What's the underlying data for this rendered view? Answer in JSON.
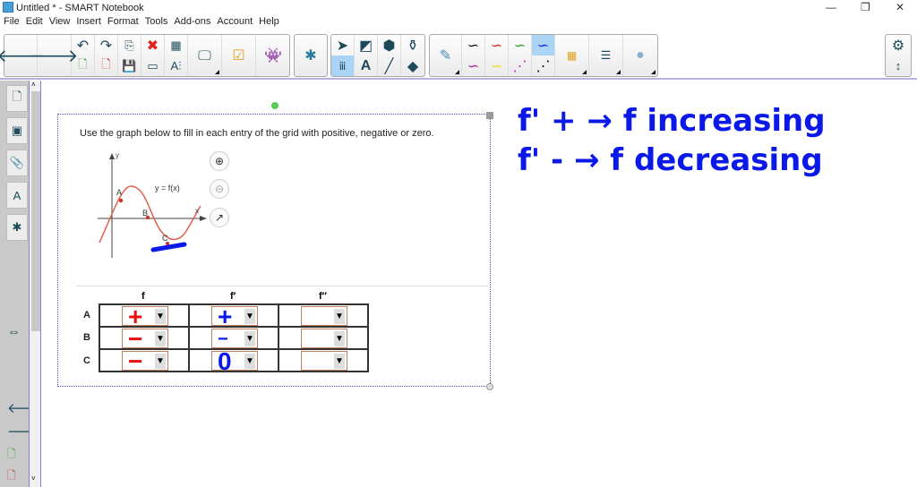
{
  "window": {
    "title": "Untitled * - SMART Notebook",
    "min": "—",
    "restore": "❐",
    "close": "✕"
  },
  "menu": [
    "File",
    "Edit",
    "View",
    "Insert",
    "Format",
    "Tools",
    "Add-ons",
    "Account",
    "Help"
  ],
  "question": {
    "text": "Use the graph below to fill in each entry of the grid with positive, negative or zero.",
    "graph": {
      "ylabel": "y",
      "xlabel": "x",
      "curve_label": "y = f(x)",
      "points": [
        "A",
        "B",
        "C"
      ]
    },
    "columns": [
      "f",
      "f′",
      "f′′"
    ],
    "rows": [
      "A",
      "B",
      "C"
    ],
    "answers": [
      [
        "+",
        "+",
        ""
      ],
      [
        "−",
        "−",
        ""
      ],
      [
        "−",
        "0",
        ""
      ]
    ]
  },
  "notes": [
    "f' + → f increasing",
    "f' - → f decreasing"
  ],
  "colors": {
    "ink_blue": "#0a18e8",
    "ink_red": "#e81010",
    "accent": "#a9d4f5"
  }
}
